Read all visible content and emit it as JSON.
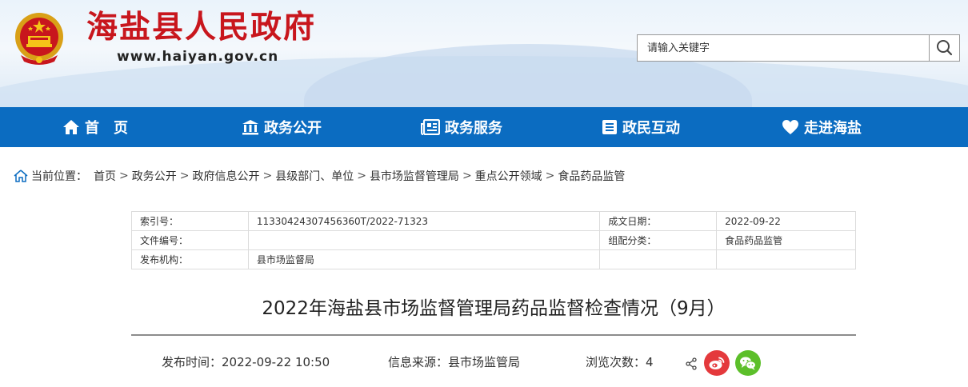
{
  "site": {
    "title": "海盐县人民政府",
    "url": "www.haiyan.gov.cn"
  },
  "search": {
    "placeholder": "请输入关键字",
    "icon": "search-icon"
  },
  "nav": {
    "items": [
      {
        "label": "首　页",
        "icon": "home-icon"
      },
      {
        "label": "政务公开",
        "icon": "building-icon"
      },
      {
        "label": "政务服务",
        "icon": "news-icon"
      },
      {
        "label": "政民互动",
        "icon": "list-icon"
      },
      {
        "label": "走进海盐",
        "icon": "heart-icon"
      }
    ]
  },
  "breadcrumb": {
    "label": "当前位置：",
    "items": [
      "首页",
      "政务公开",
      "政府信息公开",
      "县级部门、单位",
      "县市场监督管理局",
      "重点公开领域",
      "食品药品监管"
    ],
    "separator": ">"
  },
  "meta": {
    "rows": [
      {
        "k1": "索引号：",
        "v1": "11330424307456360T/2022-71323",
        "k2": "成文日期：",
        "v2": "2022-09-22"
      },
      {
        "k1": "文件编号：",
        "v1": "",
        "k2": "组配分类：",
        "v2": "食品药品监管"
      },
      {
        "k1": "发布机构：",
        "v1": "县市场监督局",
        "k2": "",
        "v2": ""
      }
    ]
  },
  "article": {
    "title": "2022年海盐县市场监督管理局药品监督检查情况（9月）",
    "publish_time": "发布时间：2022-09-22 10:50",
    "source": "信息来源：县市场监管局",
    "views_label": "浏览次数：",
    "views": "4"
  },
  "colors": {
    "nav_bg": "#0b6cc1",
    "title_red": "#c8161d",
    "weibo": "#e4393c",
    "wechat": "#5cbf2a"
  }
}
